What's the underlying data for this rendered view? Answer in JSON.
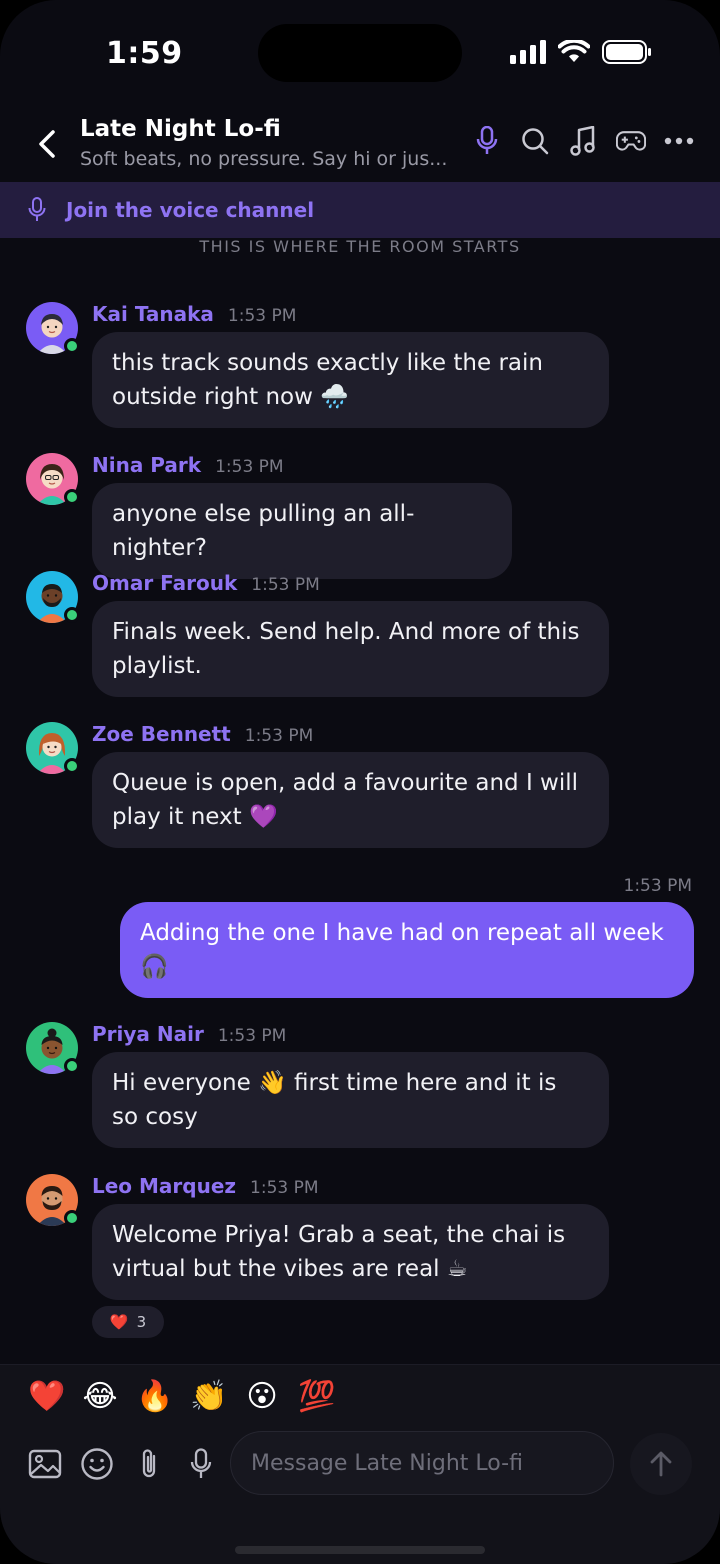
{
  "status_bar": {
    "time": "1:59"
  },
  "header": {
    "title": "Late Night Lo-fi",
    "subtitle": "Soft beats, no pressure. Say hi or jus...",
    "icons": [
      "microphone-icon",
      "search-icon",
      "music-icon",
      "gamepad-icon",
      "more-icon"
    ]
  },
  "voice_bar": {
    "label": "Join the voice channel"
  },
  "room_start": "THIS IS WHERE THE ROOM STARTS",
  "messages": [
    {
      "name": "Kai Tanaka",
      "time": "1:53 PM",
      "text": "this track sounds exactly like the rain outside right now 🌧️"
    },
    {
      "name": "Nina Park",
      "time": "1:53 PM",
      "text": "anyone else pulling an all-nighter?"
    },
    {
      "name": "Omar Farouk",
      "time": "1:53 PM",
      "text": "Finals week. Send help. And more of this playlist."
    },
    {
      "name": "Zoe Bennett",
      "time": "1:53 PM",
      "text": "Queue is open, add a favourite and I will play it next 💜"
    },
    {
      "name": "Priya Nair",
      "time": "1:53 PM",
      "text": "Hi everyone 👋 first time here and it is so cosy"
    },
    {
      "name": "Leo Marquez",
      "time": "1:53 PM",
      "text": "Welcome Priya! Grab a seat, the chai is virtual but the vibes are real ☕"
    }
  ],
  "own_message": {
    "time": "1:53 PM",
    "text": "Adding the one I have had on repeat all week 🎧"
  },
  "reaction": {
    "emoji": "❤️",
    "count": "3"
  },
  "quick_reactions": [
    "❤️",
    "😂",
    "🔥",
    "👏",
    "😮",
    "💯"
  ],
  "composer": {
    "placeholder": "Message Late Night Lo-fi"
  },
  "colors": {
    "accent": "#7a5cf5",
    "name": "#8e73f2",
    "bubble": "#1f1e2b",
    "background": "#0b0b12",
    "online": "#3ad07a"
  }
}
